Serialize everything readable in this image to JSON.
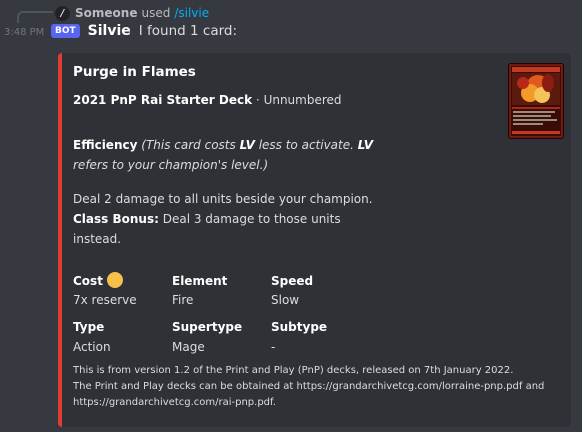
{
  "reply": {
    "avatar_glyph": "/",
    "user": "Someone",
    "text": "used",
    "command": "/silvie"
  },
  "message": {
    "timestamp": "3:48 PM",
    "bot_tag": "BOT",
    "author": "Silvie",
    "text": "I found 1 card:"
  },
  "embed": {
    "accent_color": "#e03c31",
    "title": "Purge in Flames",
    "deck": "2021 PnP Rai Starter Deck",
    "separator": "·",
    "number": "Unnumbered",
    "effect_keyword": "Efficiency",
    "effect_reminder_1": "(This card costs",
    "effect_lv_1": "LV",
    "effect_reminder_2": "less to activate.",
    "effect_lv_2": "LV",
    "effect_reminder_3": "refers to your champion's level.)",
    "effect_line_2": "Deal 2 damage to all units beside your champion.",
    "class_bonus_label": "Class Bonus:",
    "class_bonus_text_1": "Deal 3 damage to those units",
    "class_bonus_text_2": "instead.",
    "fields": [
      {
        "name": "Cost",
        "value": "7x reserve",
        "icon": "reserve-coin-icon"
      },
      {
        "name": "Element",
        "value": "Fire"
      },
      {
        "name": "Speed",
        "value": "Slow"
      },
      {
        "name": "Type",
        "value": "Action"
      },
      {
        "name": "Supertype",
        "value": "Mage"
      },
      {
        "name": "Subtype",
        "value": "-"
      }
    ],
    "footer_1": "This is from version 1.2 of the Print and Play (PnP) decks, released on 7th January 2022.",
    "footer_2": "The Print and Play decks can be obtained at https://grandarchivetcg.com/lorraine-pnp.pdf and",
    "footer_3": "https://grandarchivetcg.com/rai-pnp.pdf.",
    "card_thumbnail": "card-art-thumbnail"
  }
}
